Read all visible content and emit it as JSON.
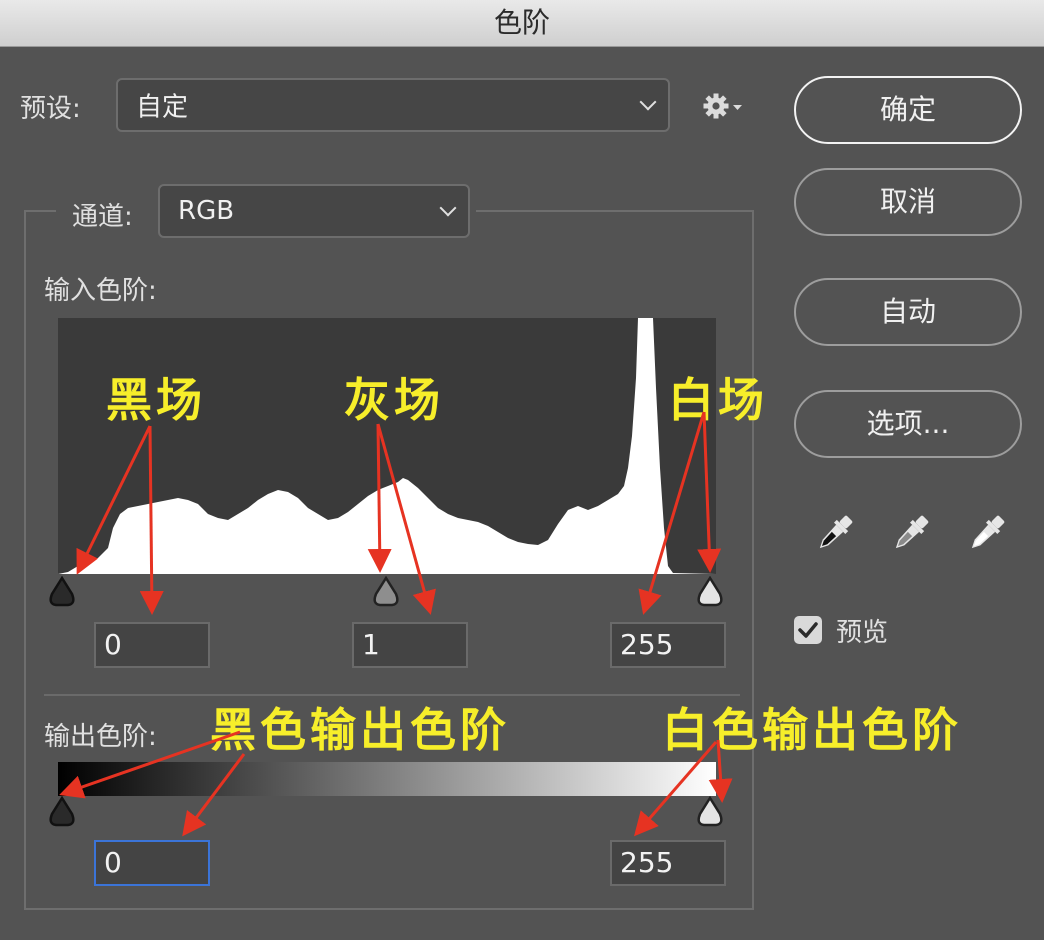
{
  "window": {
    "title": "色阶"
  },
  "preset": {
    "label": "预设:",
    "value": "自定"
  },
  "channel": {
    "label": "通道:",
    "value": "RGB"
  },
  "input_levels": {
    "label": "输入色阶:",
    "black": "0",
    "gamma": "1",
    "white": "255"
  },
  "output_levels": {
    "label": "输出色阶:",
    "black": "0",
    "white": "255"
  },
  "buttons": {
    "ok": "确定",
    "cancel": "取消",
    "auto": "自动",
    "options": "选项..."
  },
  "preview": {
    "label": "预览",
    "checked": true
  },
  "annotations": {
    "black_point": "黑场",
    "gray_point": "灰场",
    "white_point": "白场",
    "black_output": "黑色输出色阶",
    "white_output": "白色输出色阶"
  },
  "colors": {
    "dialog_bg": "#535353",
    "histogram_bg": "#3a3a3a",
    "annotation_text": "#f7ee2a",
    "annotation_arrow": "#e63322",
    "active_field_border": "#3b74d8"
  },
  "icons": {
    "gear": "gear-icon",
    "eyedroppers": [
      "black-eyedropper-icon",
      "gray-eyedropper-icon",
      "white-eyedropper-icon"
    ]
  }
}
